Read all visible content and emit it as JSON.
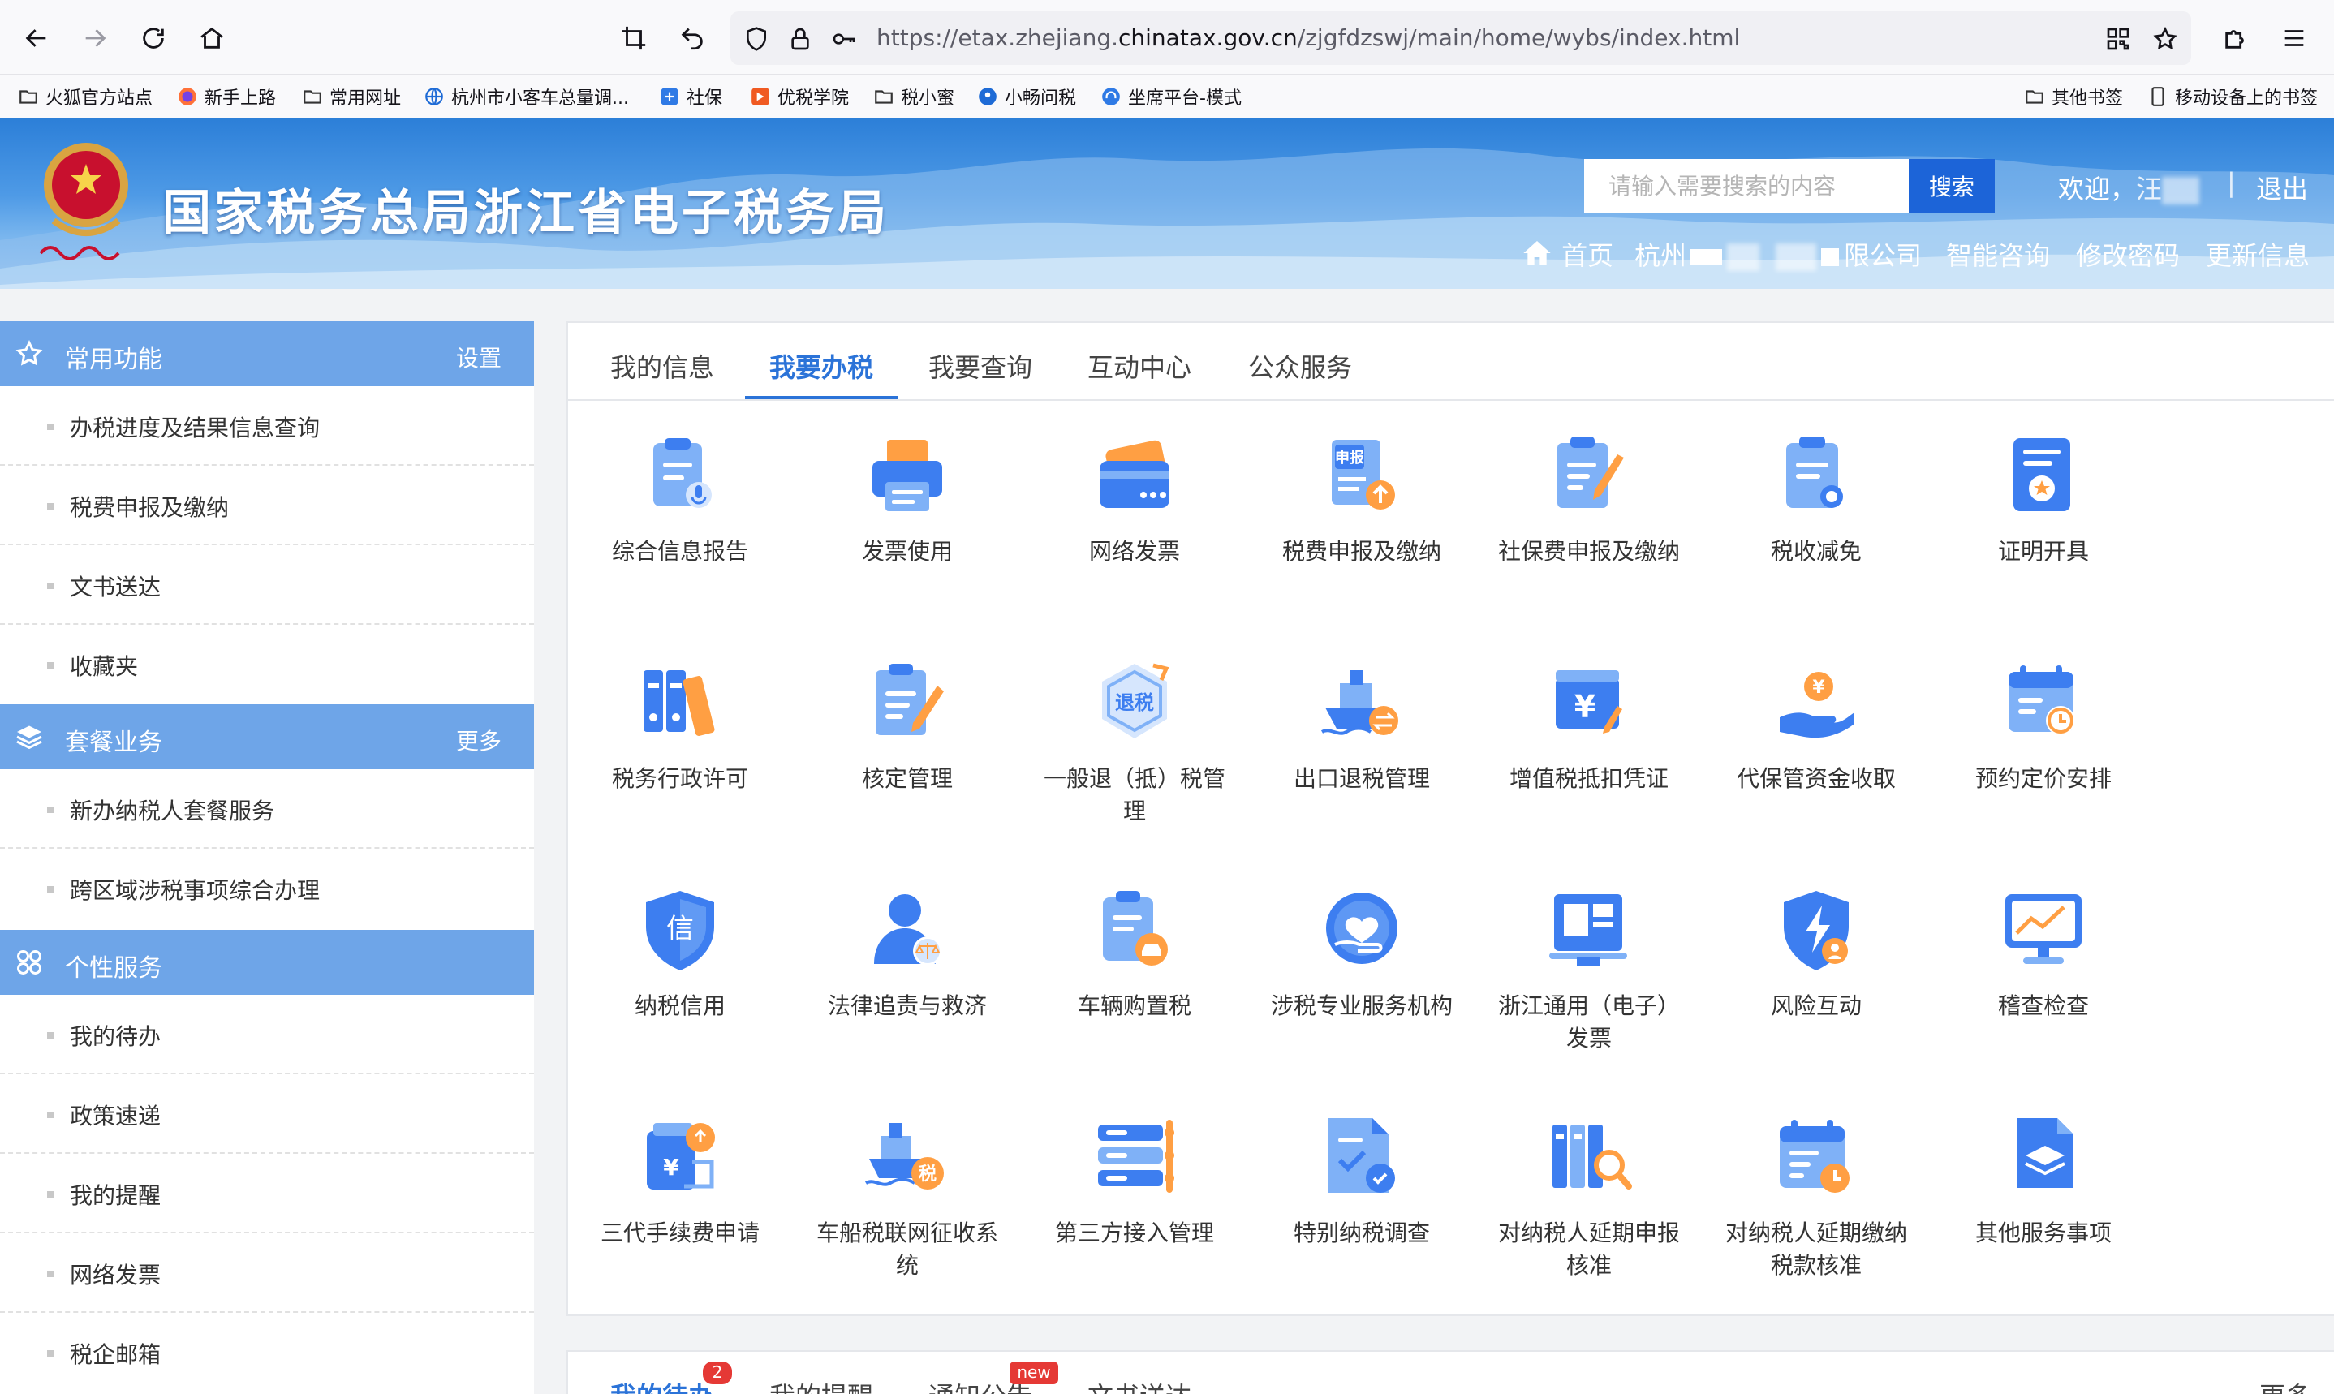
{
  "browser": {
    "url_prefix": "https://etax.zhejiang.",
    "url_domain": "chinatax.gov.cn",
    "url_path": "/zjgfdzswj/main/home/wybs/index.html"
  },
  "bookmarks": [
    {
      "label": "火狐官方站点",
      "icon": "folder-icon"
    },
    {
      "label": "新手上路",
      "icon": "firefox-icon"
    },
    {
      "label": "常用网址",
      "icon": "folder-icon"
    },
    {
      "label": "杭州市小客车总量调...",
      "icon": "globe-icon"
    },
    {
      "label": "社保",
      "icon": "app-icon"
    },
    {
      "label": "优税学院",
      "icon": "app-icon"
    },
    {
      "label": "税小蜜",
      "icon": "folder-icon"
    },
    {
      "label": "小畅问税",
      "icon": "location-icon"
    },
    {
      "label": "坐席平台-模式",
      "icon": "headset-icon"
    }
  ],
  "bookmarks_right": [
    {
      "label": "其他书签",
      "icon": "folder-icon"
    },
    {
      "label": "移动设备上的书签",
      "icon": "mobile-icon"
    }
  ],
  "header": {
    "title": "国家税务总局浙江省电子税务局",
    "search_placeholder": "请输入需要搜索的内容",
    "search_button": "搜索",
    "welcome": "欢迎，",
    "user_initial": "汪",
    "logout": "退出",
    "home": "首页",
    "company_prefix": "杭州",
    "company_suffix": "限公司",
    "links": [
      "智能咨询",
      "修改密码",
      "更新信息"
    ],
    "colors": {
      "search_button": "#1c64d8"
    }
  },
  "sidebar": {
    "sections": [
      {
        "title": "常用功能",
        "action": "设置",
        "items": [
          "办税进度及结果信息查询",
          "税费申报及缴纳",
          "文书送达",
          "收藏夹"
        ]
      },
      {
        "title": "套餐业务",
        "action": "更多",
        "items": [
          "新办纳税人套餐服务",
          "跨区域涉税事项综合办理"
        ]
      },
      {
        "title": "个性服务",
        "action": "",
        "items": [
          "我的待办",
          "政策速递",
          "我的提醒",
          "网络发票",
          "税企邮箱"
        ]
      }
    ],
    "colors": {
      "section_header": "#6ea5e8"
    }
  },
  "main": {
    "tabs": [
      "我的信息",
      "我要办税",
      "我要查询",
      "互动中心",
      "公众服务"
    ],
    "active_tab": "我要办税",
    "tiles": [
      {
        "label": "综合信息报告",
        "icon": "info-report-icon"
      },
      {
        "label": "发票使用",
        "icon": "printer-icon"
      },
      {
        "label": "网络发票",
        "icon": "card-icon"
      },
      {
        "label": "税费申报及缴纳",
        "icon": "declare-icon"
      },
      {
        "label": "社保费申报及缴纳",
        "icon": "clipboard-pen-icon"
      },
      {
        "label": "税收减免",
        "icon": "tax-reduction-icon"
      },
      {
        "label": "证明开具",
        "icon": "certificate-icon"
      },
      {
        "label": "税务行政许可",
        "icon": "binders-icon"
      },
      {
        "label": "核定管理",
        "icon": "clipboard-edit-icon"
      },
      {
        "label": "一般退（抵）税管理",
        "icon": "tax-refund-icon"
      },
      {
        "label": "出口退税管理",
        "icon": "ship-icon"
      },
      {
        "label": "增值税抵扣凭证",
        "icon": "yuan-receipt-icon"
      },
      {
        "label": "代保管资金收取",
        "icon": "hand-coin-icon"
      },
      {
        "label": "预约定价安排",
        "icon": "calendar-clock-icon"
      },
      {
        "label": "纳税信用",
        "icon": "credit-shield-icon"
      },
      {
        "label": "法律追责与救济",
        "icon": "law-scale-icon"
      },
      {
        "label": "车辆购置税",
        "icon": "vehicle-tax-icon"
      },
      {
        "label": "涉税专业服务机构",
        "icon": "heart-hand-icon"
      },
      {
        "label": "浙江通用（电子）发票",
        "icon": "e-invoice-icon"
      },
      {
        "label": "风险互动",
        "icon": "risk-shield-icon"
      },
      {
        "label": "稽查检查",
        "icon": "monitor-chart-icon"
      },
      {
        "label": "三代手续费申请",
        "icon": "fee-application-icon"
      },
      {
        "label": "车船税联网征收系统",
        "icon": "ship-tax-icon"
      },
      {
        "label": "第三方接入管理",
        "icon": "server-icon"
      },
      {
        "label": "特别纳税调查",
        "icon": "special-survey-icon"
      },
      {
        "label": "对纳税人延期申报核准",
        "icon": "books-search-icon"
      },
      {
        "label": "对纳税人延期缴纳税款核准",
        "icon": "calendar-delay-icon"
      },
      {
        "label": "其他服务事项",
        "icon": "layers-icon"
      }
    ]
  },
  "bottom": {
    "tabs": [
      "我的待办",
      "我的提醒",
      "通知公告",
      "文书送达"
    ],
    "todo_badge": "2",
    "notice_badge": "new",
    "more": "更多"
  }
}
